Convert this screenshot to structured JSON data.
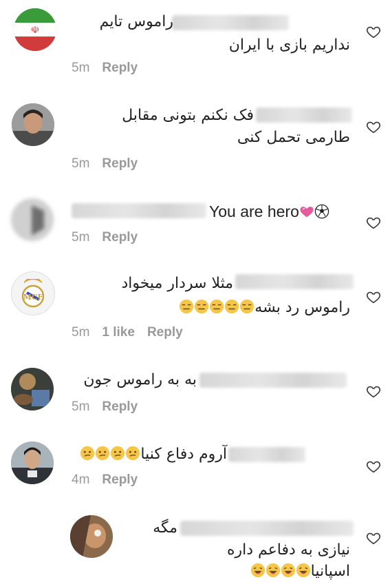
{
  "comments": [
    {
      "line1": "راموس تایم",
      "line2": "نداریم بازی با ایران",
      "time": "5m",
      "likes": "",
      "reply_label": "Reply",
      "avatar_icon": "iran-flag-avatar"
    },
    {
      "line1": "فک نکنم بتونی مقابل",
      "line2": "طارمی تحمل کنی",
      "time": "5m",
      "likes": "",
      "reply_label": "Reply",
      "avatar_icon": "man-photo-avatar"
    },
    {
      "line1": "You are hero",
      "line2": "",
      "time": "5m",
      "likes": "",
      "reply_label": "Reply",
      "avatar_icon": "blurred-avatar"
    },
    {
      "line1": "مثلا سردار میخواد",
      "line2": "راموس رد بشه",
      "time": "5m",
      "likes": "1 like",
      "reply_label": "Reply",
      "avatar_icon": "real-madrid-crest-avatar"
    },
    {
      "line1": "به به  راموس جون",
      "line2": "",
      "time": "5m",
      "likes": "",
      "reply_label": "Reply",
      "avatar_icon": "dark-photo-avatar"
    },
    {
      "line1": "آروم دفاع کنیا",
      "line2": "",
      "time": "4m",
      "likes": "",
      "reply_label": "Reply",
      "avatar_icon": "man-photo-avatar"
    },
    {
      "line1": "مگه",
      "line2": "نیازی به دفاعم داره",
      "line3": "اسپانیا",
      "time": "",
      "likes": "",
      "reply_label": "",
      "avatar_icon": "sepia-photo-avatar"
    }
  ],
  "icons": {
    "like": "heart-outline-icon",
    "emoji_expressionless": "expressionless-face-emoji",
    "emoji_confused": "confused-face-emoji",
    "emoji_laughing": "laughing-face-emoji",
    "emoji_pink_heart": "sparkling-heart-emoji",
    "emoji_ball": "soccer-ball-emoji"
  },
  "colors": {
    "meta_text": "#999999",
    "emoji_yellow": "#f5c64a",
    "heart_pink": "#e55a9c"
  }
}
